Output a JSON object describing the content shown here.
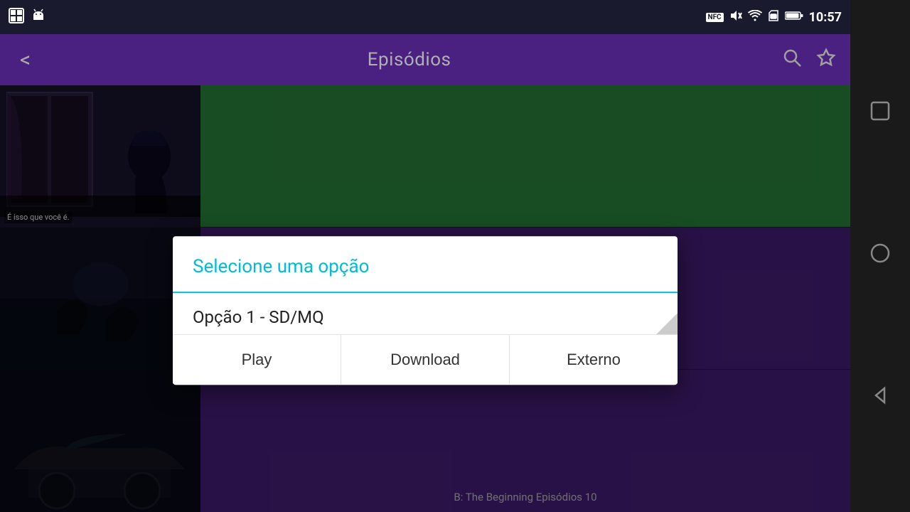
{
  "statusBar": {
    "time": "10:57",
    "icons": {
      "nfc": "NFC",
      "mute": "🔇",
      "wifi": "📶",
      "sim": "📱",
      "battery": "🔋"
    }
  },
  "header": {
    "title": "Episódios",
    "backLabel": "<",
    "searchLabel": "🔍",
    "favoriteLabel": "☆"
  },
  "episodes": [
    {
      "thumbnailAlt": "Anime scene 1",
      "thumbOverlay": "É isso que você é.",
      "backgroundColor": "#2d8a3e"
    },
    {
      "thumbnailAlt": "Anime scene 2",
      "backgroundColor": "#3d1f6e"
    },
    {
      "thumbnailAlt": "Anime scene 3",
      "episodeTitle": "B: The Beginning Episódios 10",
      "backgroundColor": "#3d1f6e"
    }
  ],
  "dialog": {
    "title": "Selecione uma opção",
    "optionText": "Opção 1 - SD/MQ",
    "buttons": {
      "play": "Play",
      "download": "Download",
      "external": "Externo"
    }
  },
  "navBar": {
    "squareIcon": "□",
    "circleIcon": "○",
    "backIcon": "◁"
  }
}
